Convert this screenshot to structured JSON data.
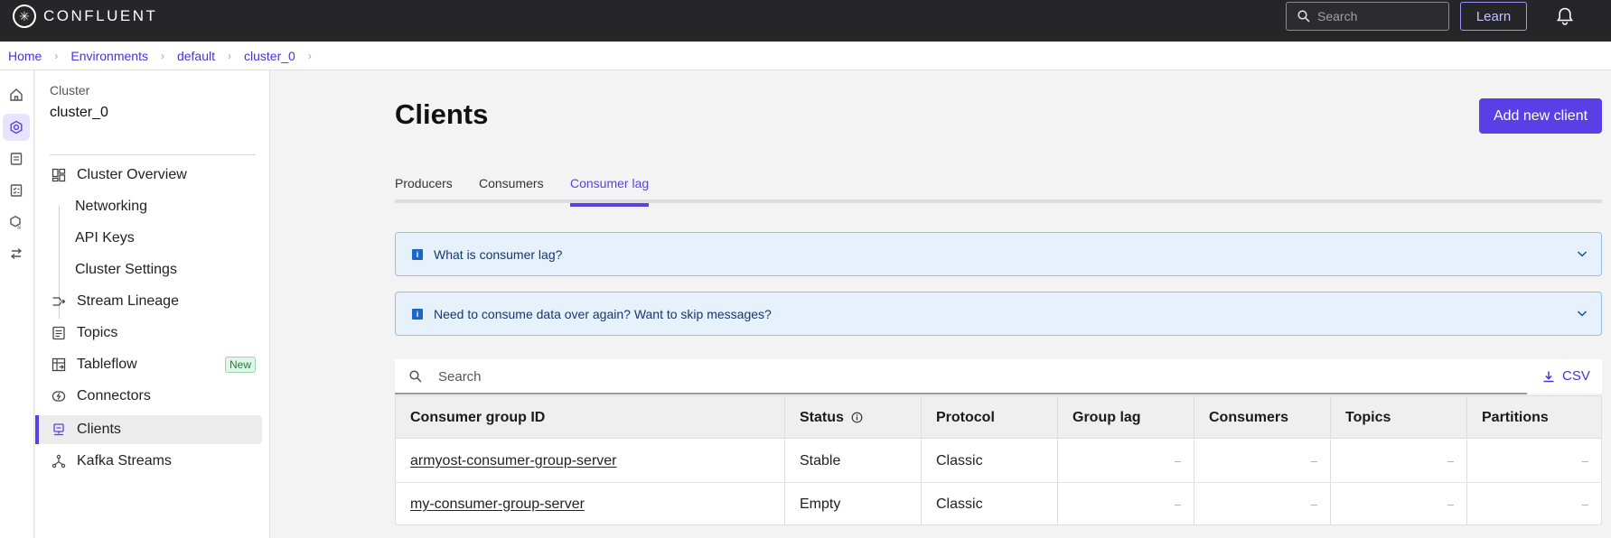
{
  "topbar": {
    "brand": "CONFLUENT",
    "search_placeholder": "Search",
    "learn_label": "Learn"
  },
  "breadcrumb": [
    "Home",
    "Environments",
    "default",
    "cluster_0"
  ],
  "sidebar": {
    "cluster_label": "Cluster",
    "cluster_name": "cluster_0",
    "items": [
      {
        "label": "Cluster Overview",
        "icon": "dashboard-icon"
      },
      {
        "label": "Networking"
      },
      {
        "label": "API Keys"
      },
      {
        "label": "Cluster Settings"
      },
      {
        "label": "Stream Lineage",
        "icon": "lineage-icon"
      },
      {
        "label": "Topics",
        "icon": "topics-icon"
      },
      {
        "label": "Tableflow",
        "icon": "tableflow-icon",
        "badge": "New"
      },
      {
        "label": "Connectors",
        "icon": "connectors-icon"
      },
      {
        "label": "Clients",
        "icon": "clients-icon",
        "active": true
      },
      {
        "label": "Kafka Streams",
        "icon": "kafka-streams-icon"
      }
    ]
  },
  "main": {
    "title": "Clients",
    "add_button": "Add new client",
    "tabs": [
      "Producers",
      "Consumers",
      "Consumer lag"
    ],
    "active_tab": "Consumer lag",
    "info_boxes": [
      "What is consumer lag?",
      "Need to consume data over again? Want to skip messages?"
    ],
    "search_placeholder": "Search",
    "csv_label": "CSV",
    "table": {
      "columns": [
        "Consumer group ID",
        "Status",
        "Protocol",
        "Group lag",
        "Consumers",
        "Topics",
        "Partitions"
      ],
      "rows": [
        [
          "armyost-consumer-group-server",
          "Stable",
          "Classic",
          "–",
          "–",
          "–",
          "–"
        ],
        [
          "my-consumer-group-server",
          "Empty",
          "Classic",
          "–",
          "–",
          "–",
          "–"
        ]
      ]
    }
  },
  "colors": {
    "accent": "#5b3fe6",
    "topbar": "#262629",
    "info_bg": "#e7f1fc"
  }
}
